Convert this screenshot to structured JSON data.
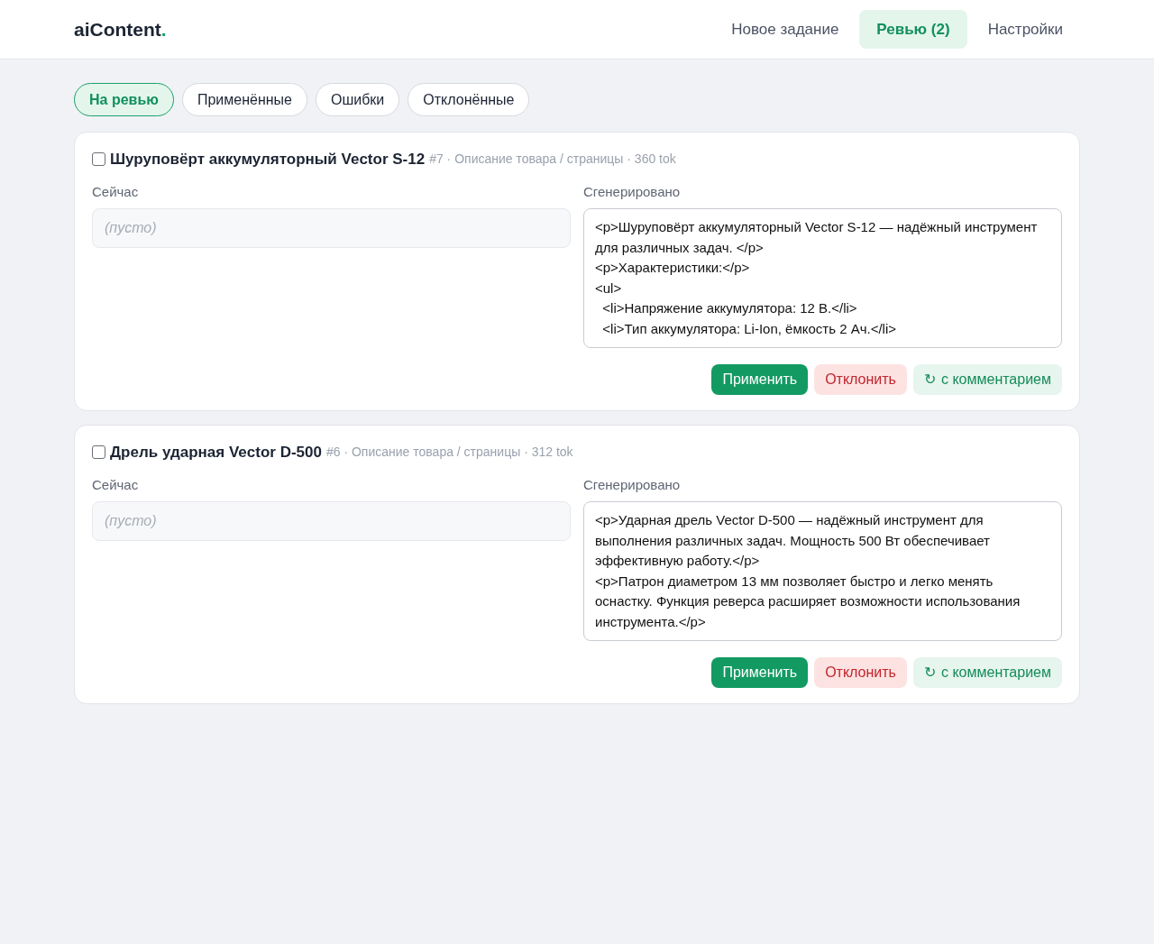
{
  "logo": {
    "text": "aiContent",
    "dot": "."
  },
  "nav": [
    {
      "label": "Новое задание",
      "selected": false
    },
    {
      "label": "Ревью (2)",
      "selected": true
    },
    {
      "label": "Настройки",
      "selected": false
    }
  ],
  "filters": [
    {
      "label": "На ревью",
      "selected": true
    },
    {
      "label": "Применённые",
      "selected": false
    },
    {
      "label": "Ошибки",
      "selected": false
    },
    {
      "label": "Отклонённые",
      "selected": false
    }
  ],
  "items": [
    {
      "checked": false,
      "title": "Шуруповёрт аккумуляторный Vector S-12",
      "meta": "#7 · Описание товара / страницы · 360 tok",
      "current_label": "Сейчас",
      "current_placeholder": "(пусто)",
      "generated_label": "Сгенерировано",
      "generated": "<p>Шуруповёрт аккумуляторный Vector S-12 — надёжный инструмент для различных задач. </p>\n<p>Характеристики:</p>\n<ul>\n  <li>Напряжение аккумулятора: 12 В.</li>\n  <li>Тип аккумулятора: Li-Ion, ёмкость 2 Ач.</li>",
      "buttons": [
        {
          "kind": "apply",
          "label": "Применить"
        },
        {
          "kind": "reject",
          "label": "Отклонить"
        },
        {
          "kind": "comment",
          "icon": "↻",
          "label": "с комментарием"
        }
      ]
    },
    {
      "checked": false,
      "title": "Дрель ударная Vector D-500",
      "meta": "#6 · Описание товара / страницы · 312 tok",
      "current_label": "Сейчас",
      "current_placeholder": "(пусто)",
      "generated_label": "Сгенерировано",
      "generated": "<p>Ударная дрель Vector D-500 — надёжный инструмент для выполнения различных задач. Мощность 500 Вт обеспечивает эффективную работу.</p>\n<p>Патрон диаметром 13 мм позволяет быстро и легко менять оснастку. Функция реверса расширяет возможности использования инструмента.</p>",
      "buttons": [
        {
          "kind": "apply",
          "label": "Применить"
        },
        {
          "kind": "reject",
          "label": "Отклонить"
        },
        {
          "kind": "comment",
          "icon": "↻",
          "label": "с комментарием"
        }
      ]
    }
  ]
}
